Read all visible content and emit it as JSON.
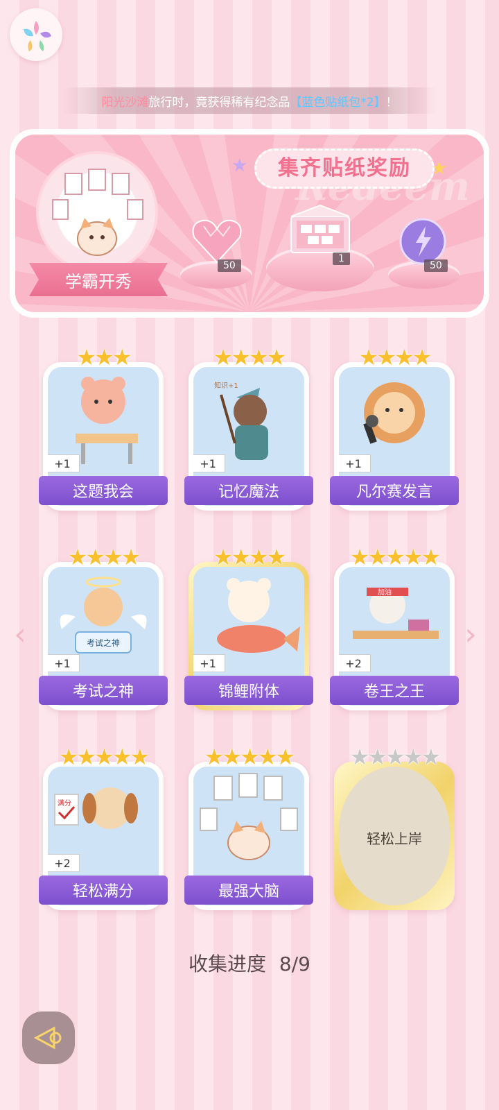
{
  "ticker": {
    "location": "阳光沙滩",
    "text": "旅行时，竟获得稀有纪念品",
    "item": "【蓝色贴纸包*2】",
    "end": "！"
  },
  "banner": {
    "title": "集齐贴纸奖励",
    "watermark": "Redeem",
    "collection_name": "学霸开秀",
    "rewards": [
      {
        "name": "heart-gem",
        "count": "50"
      },
      {
        "name": "sticker-gift-box",
        "count": "1"
      },
      {
        "name": "energy-orb",
        "count": "50"
      }
    ]
  },
  "stickers": [
    {
      "label": "这题我会",
      "bonus": "+1",
      "stars": "★★★",
      "variant": "normal"
    },
    {
      "label": "记忆魔法",
      "bonus": "+1",
      "stars": "★★★★",
      "variant": "normal"
    },
    {
      "label": "凡尔赛发言",
      "bonus": "+1",
      "stars": "★★★★",
      "variant": "normal"
    },
    {
      "label": "考试之神",
      "bonus": "+1",
      "stars": "★★★★",
      "variant": "normal"
    },
    {
      "label": "锦鲤附体",
      "bonus": "+1",
      "stars": "★★★★",
      "variant": "gold"
    },
    {
      "label": "卷王之王",
      "bonus": "+2",
      "stars": "★★★★★",
      "variant": "normal"
    },
    {
      "label": "轻松满分",
      "bonus": "+2",
      "stars": "★★★★★",
      "variant": "normal"
    },
    {
      "label": "最强大脑",
      "bonus": "",
      "stars": "★★★★★",
      "variant": "normal"
    },
    {
      "label": "轻松上岸",
      "bonus": "",
      "stars": "★★★★★",
      "variant": "locked"
    }
  ],
  "progress": {
    "label": "收集进度",
    "value": "8/9"
  },
  "icons": {
    "logo": "app-logo-icon",
    "prev": "chevron-left-icon",
    "next": "chevron-right-icon",
    "back": "back-arrow-icon"
  }
}
